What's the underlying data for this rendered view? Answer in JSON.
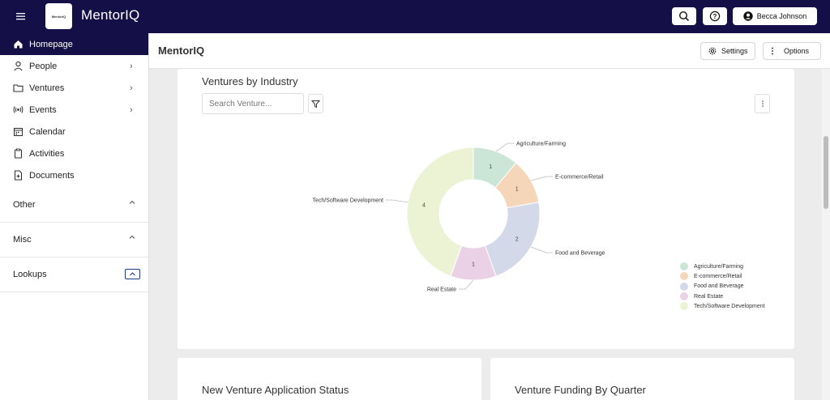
{
  "topbar": {
    "brand": "MentorIQ",
    "logo_text": "MentorIQ",
    "user_name": "Becca Johnson",
    "bg_color": "#150f47"
  },
  "sidebar": {
    "items": [
      {
        "label": "Homepage",
        "icon": "home-icon"
      },
      {
        "label": "People",
        "icon": "person-icon"
      },
      {
        "label": "Ventures",
        "icon": "folder-icon"
      },
      {
        "label": "Events",
        "icon": "broadcast-icon"
      },
      {
        "label": "Calendar",
        "icon": "calendar-icon"
      },
      {
        "label": "Activities",
        "icon": "clipboard-icon"
      },
      {
        "label": "Documents",
        "icon": "document-icon"
      }
    ],
    "sections": [
      {
        "label": "Other"
      },
      {
        "label": "Misc"
      },
      {
        "label": "Lookups"
      }
    ]
  },
  "subheader": {
    "title": "MentorIQ",
    "settings_label": "Settings",
    "options_label": "Options"
  },
  "ventures_card": {
    "title": "Ventures by Industry",
    "search_placeholder": "Search Venture..."
  },
  "chart_data": {
    "type": "pie",
    "title": "Ventures by Industry",
    "categories": [
      "Agriculture/Farming",
      "E-commerce/Retail",
      "Food and Beverage",
      "Real Estate",
      "Tech/Software Development"
    ],
    "values": [
      1,
      1,
      2,
      1,
      4
    ],
    "colors": [
      "#cbe6d6",
      "#f5d6b9",
      "#d4d9e9",
      "#ebd1e6",
      "#ebf3d4"
    ],
    "legend_position": "bottom-right"
  },
  "bottom_cards": {
    "left_title": "New Venture Application Status",
    "right_title": "Venture Funding By Quarter"
  }
}
